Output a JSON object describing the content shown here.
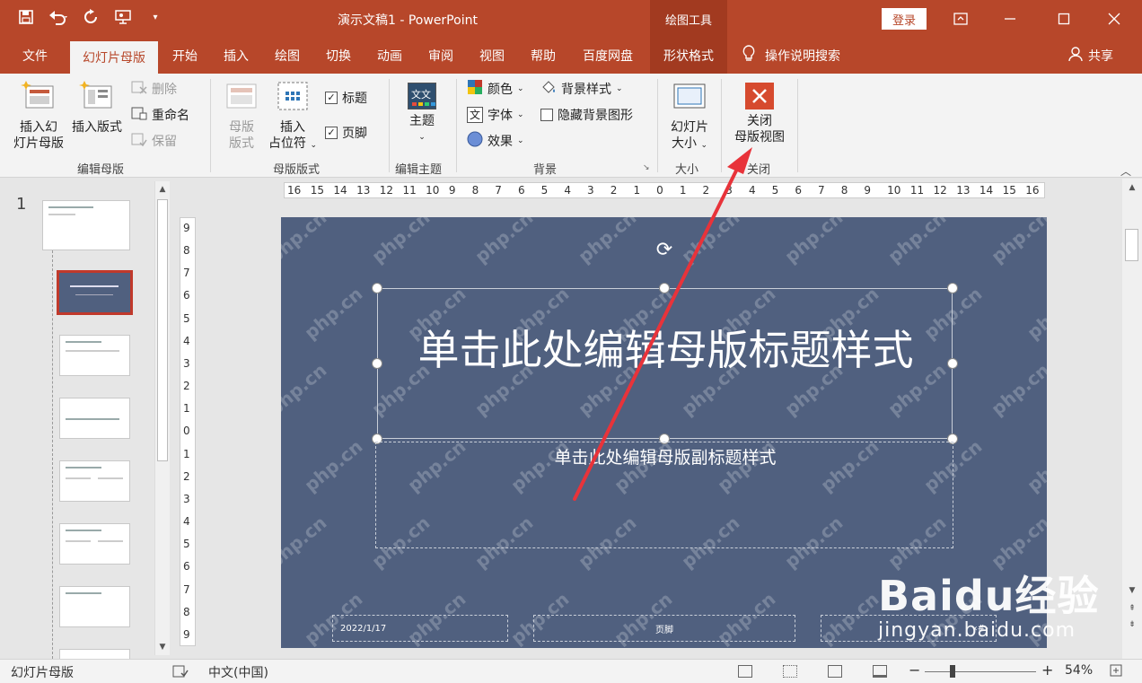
{
  "titlebar": {
    "doc_title": "演示文稿1  -  PowerPoint",
    "context_tool": "绘图工具",
    "login": "登录",
    "qat_icons": [
      "save-icon",
      "undo-icon",
      "redo-icon",
      "present-icon",
      "customize-icon"
    ]
  },
  "tabs": [
    "文件",
    "幻灯片母版",
    "开始",
    "插入",
    "绘图",
    "切换",
    "动画",
    "审阅",
    "视图",
    "帮助",
    "百度网盘",
    "形状格式"
  ],
  "search_hint": "操作说明搜索",
  "share": "共享",
  "ribbon": {
    "edit_master": {
      "label": "编辑母版",
      "insert_master_l1": "插入幻",
      "insert_master_l2": "灯片母版",
      "insert_layout": "插入版式",
      "delete": "删除",
      "rename": "重命名",
      "preserve": "保留"
    },
    "master_layout": {
      "label": "母版版式",
      "master_layout_l1": "母版",
      "master_layout_l2": "版式",
      "insert_placeholder_l1": "插入",
      "insert_placeholder_l2": "占位符",
      "title_check": "标题",
      "footer_check": "页脚"
    },
    "edit_theme": {
      "label": "编辑主题",
      "theme": "主题",
      "theme_icon_text": "文文"
    },
    "background": {
      "label": "背景",
      "colors": "颜色",
      "fonts": "字体",
      "effects": "效果",
      "bg_styles": "背景样式",
      "hide_bg": "隐藏背景图形"
    },
    "size": {
      "label": "大小",
      "slide_size_l1": "幻灯片",
      "slide_size_l2": "大小"
    },
    "close": {
      "label": "关闭",
      "close_l1": "关闭",
      "close_l2": "母版视图"
    }
  },
  "thumbnails": {
    "first_number": "1"
  },
  "slide": {
    "title": "单击此处编辑母版标题样式",
    "subtitle": "单击此处编辑母版副标题样式",
    "date": "2022/1/17",
    "footer": "页脚",
    "page_number": "‹#›",
    "watermark": "php.cn"
  },
  "ruler": {
    "h": [
      "16",
      "15",
      "14",
      "13",
      "12",
      "11",
      "10",
      "9",
      "8",
      "7",
      "6",
      "5",
      "4",
      "3",
      "2",
      "1",
      "0",
      "1",
      "2",
      "3",
      "4",
      "5",
      "6",
      "7",
      "8",
      "9",
      "10",
      "11",
      "12",
      "13",
      "14",
      "15",
      "16"
    ],
    "v": [
      "9",
      "8",
      "7",
      "6",
      "5",
      "4",
      "3",
      "2",
      "1",
      "0",
      "1",
      "2",
      "3",
      "4",
      "5",
      "6",
      "7",
      "8",
      "9"
    ]
  },
  "statusbar": {
    "mode": "幻灯片母版",
    "language": "中文(中国)",
    "zoom": "54%"
  },
  "baidu": {
    "brand": "Baidu经验",
    "url": "jingyan.baidu.com"
  }
}
